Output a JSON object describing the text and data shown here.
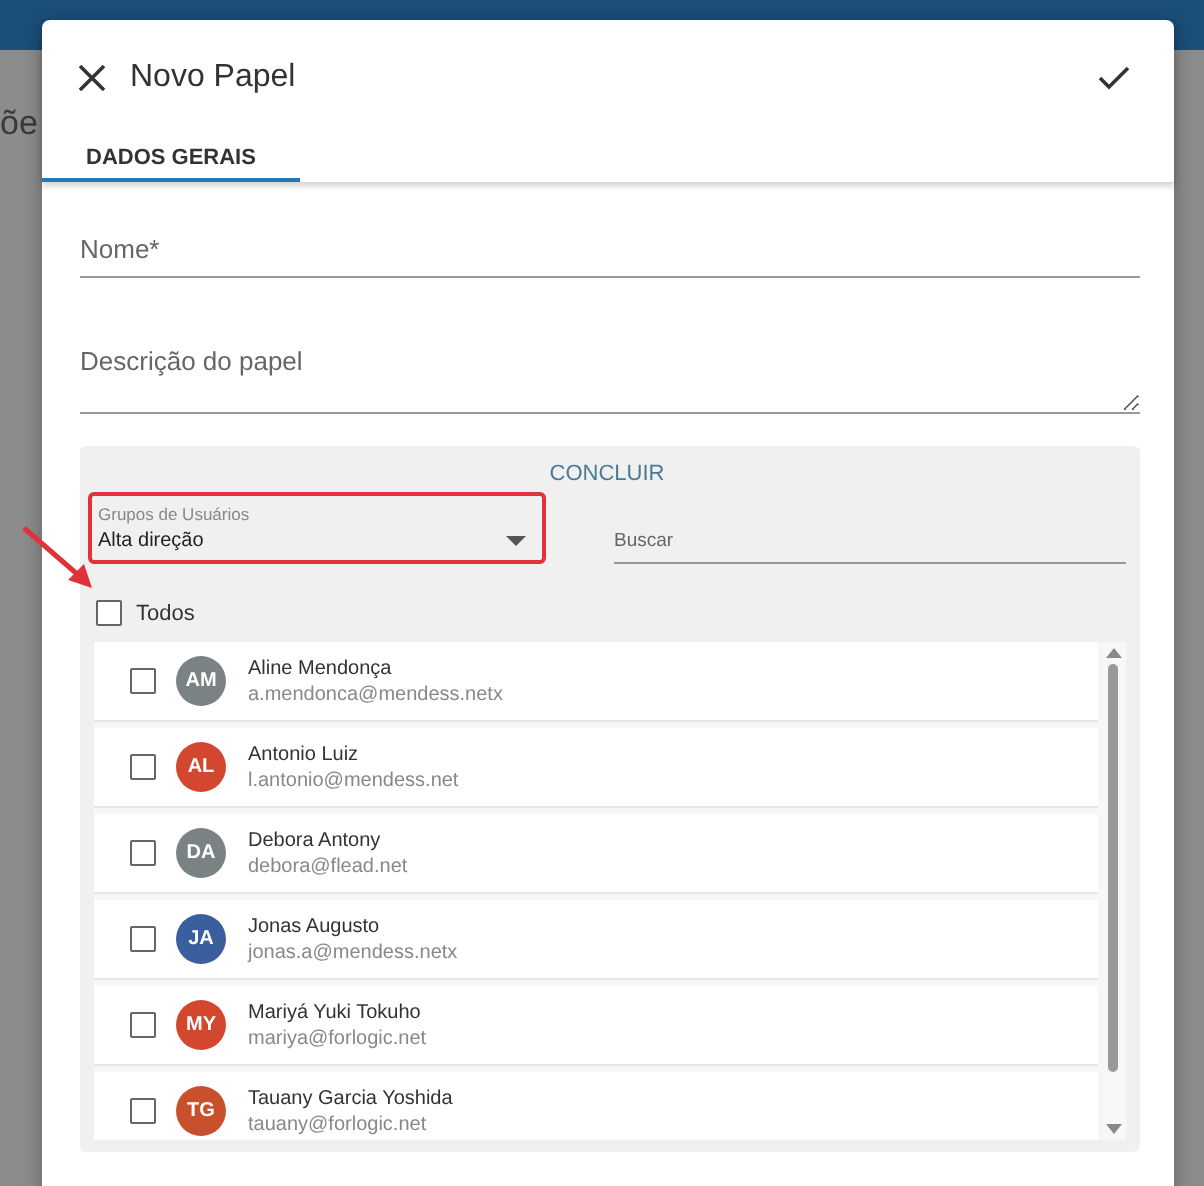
{
  "background": {
    "title_fragment": "õe"
  },
  "dialog": {
    "title": "Novo Papel"
  },
  "tabs": [
    {
      "label": "DADOS GERAIS",
      "selected": true
    }
  ],
  "fields": [
    {
      "placeholder": "Nome*",
      "kind": "input"
    },
    {
      "placeholder": "Descrição do papel",
      "kind": "textarea"
    }
  ],
  "panel": {
    "action": "CONCLUIR",
    "group_select": {
      "label": "Grupos de Usuários",
      "value": "Alta direção",
      "highlighted": true
    },
    "search": {
      "placeholder": "Buscar"
    },
    "select_all": {
      "label": "Todos",
      "checked": false
    },
    "users": [
      {
        "initials": "AM",
        "name": "Aline Mendonça",
        "email": "a.mendonca@mendess.netx",
        "color": "#7b8283",
        "checked": false
      },
      {
        "initials": "AL",
        "name": "Antonio Luiz",
        "email": "l.antonio@mendess.net",
        "color": "#d4472f",
        "checked": false
      },
      {
        "initials": "DA",
        "name": "Debora Antony",
        "email": "debora@flead.net",
        "color": "#7b8283",
        "checked": false
      },
      {
        "initials": "JA",
        "name": "Jonas Augusto",
        "email": "jonas.a@mendess.netx",
        "color": "#3b5e9e",
        "checked": false
      },
      {
        "initials": "MY",
        "name": "Mariyá Yuki Tokuho",
        "email": "mariya@forlogic.net",
        "color": "#d4472f",
        "checked": false
      },
      {
        "initials": "TG",
        "name": "Tauany Garcia Yoshida",
        "email": "tauany@forlogic.net",
        "color": "#c9502c",
        "checked": false
      }
    ]
  }
}
